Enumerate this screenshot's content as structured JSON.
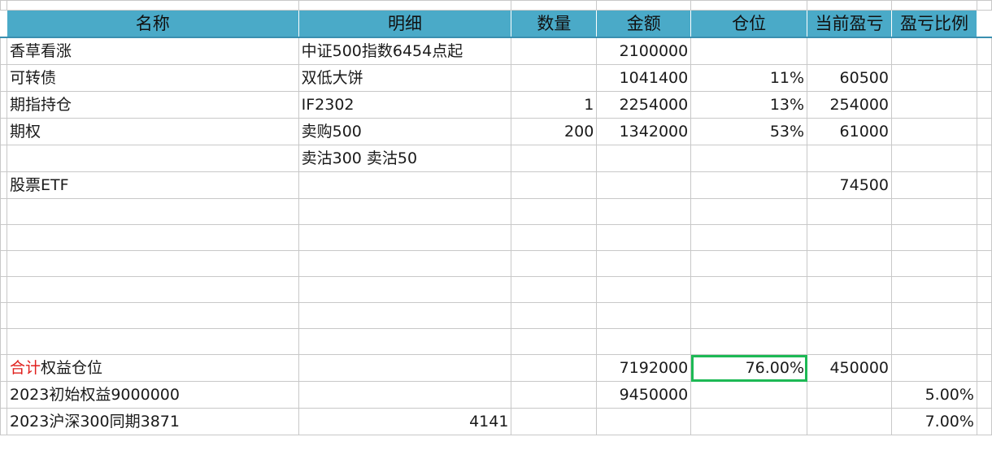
{
  "header": {
    "name": "名称",
    "detail": "明细",
    "qty": "数量",
    "amount": "金额",
    "position": "仓位",
    "pnl": "当前盈亏",
    "pnl_ratio": "盈亏比例"
  },
  "rows": [
    {
      "name": "香草看涨",
      "detail": "中证500指数6454点起",
      "qty": "",
      "amount": "2100000",
      "position": "",
      "pnl": "",
      "pnl_ratio": ""
    },
    {
      "name": "可转债",
      "detail": "双低大饼",
      "qty": "",
      "amount": "1041400",
      "position": "11%",
      "pnl": "60500",
      "pnl_ratio": ""
    },
    {
      "name": "期指持仓",
      "detail": "IF2302",
      "qty": "1",
      "amount": "2254000",
      "position": "13%",
      "pnl": "254000",
      "pnl_ratio": ""
    },
    {
      "name": "期权",
      "detail": "卖购500",
      "qty": "200",
      "amount": "1342000",
      "position": "53%",
      "pnl": "61000",
      "pnl_ratio": ""
    },
    {
      "name": "",
      "detail": "卖沽300 卖沽50",
      "qty": "",
      "amount": "",
      "position": "",
      "pnl": "",
      "pnl_ratio": ""
    },
    {
      "name": "股票ETF",
      "detail": "",
      "qty": "",
      "amount": "",
      "position": "",
      "pnl": "74500",
      "pnl_ratio": ""
    }
  ],
  "total": {
    "name_red": "合计",
    "name_rest": "权益仓位",
    "amount": "7192000",
    "position": "76.00%",
    "pnl": "450000"
  },
  "initial": {
    "name": "2023初始权益9000000",
    "amount": "9450000",
    "pnl_ratio": "5.00%"
  },
  "hs300": {
    "name": "2023沪深300同期3871",
    "detail": "4141",
    "pnl_ratio": "7.00%"
  },
  "colors": {
    "header_bg": "#4aaac8",
    "selected_border": "#1db955",
    "red_text": "#e0211e"
  }
}
